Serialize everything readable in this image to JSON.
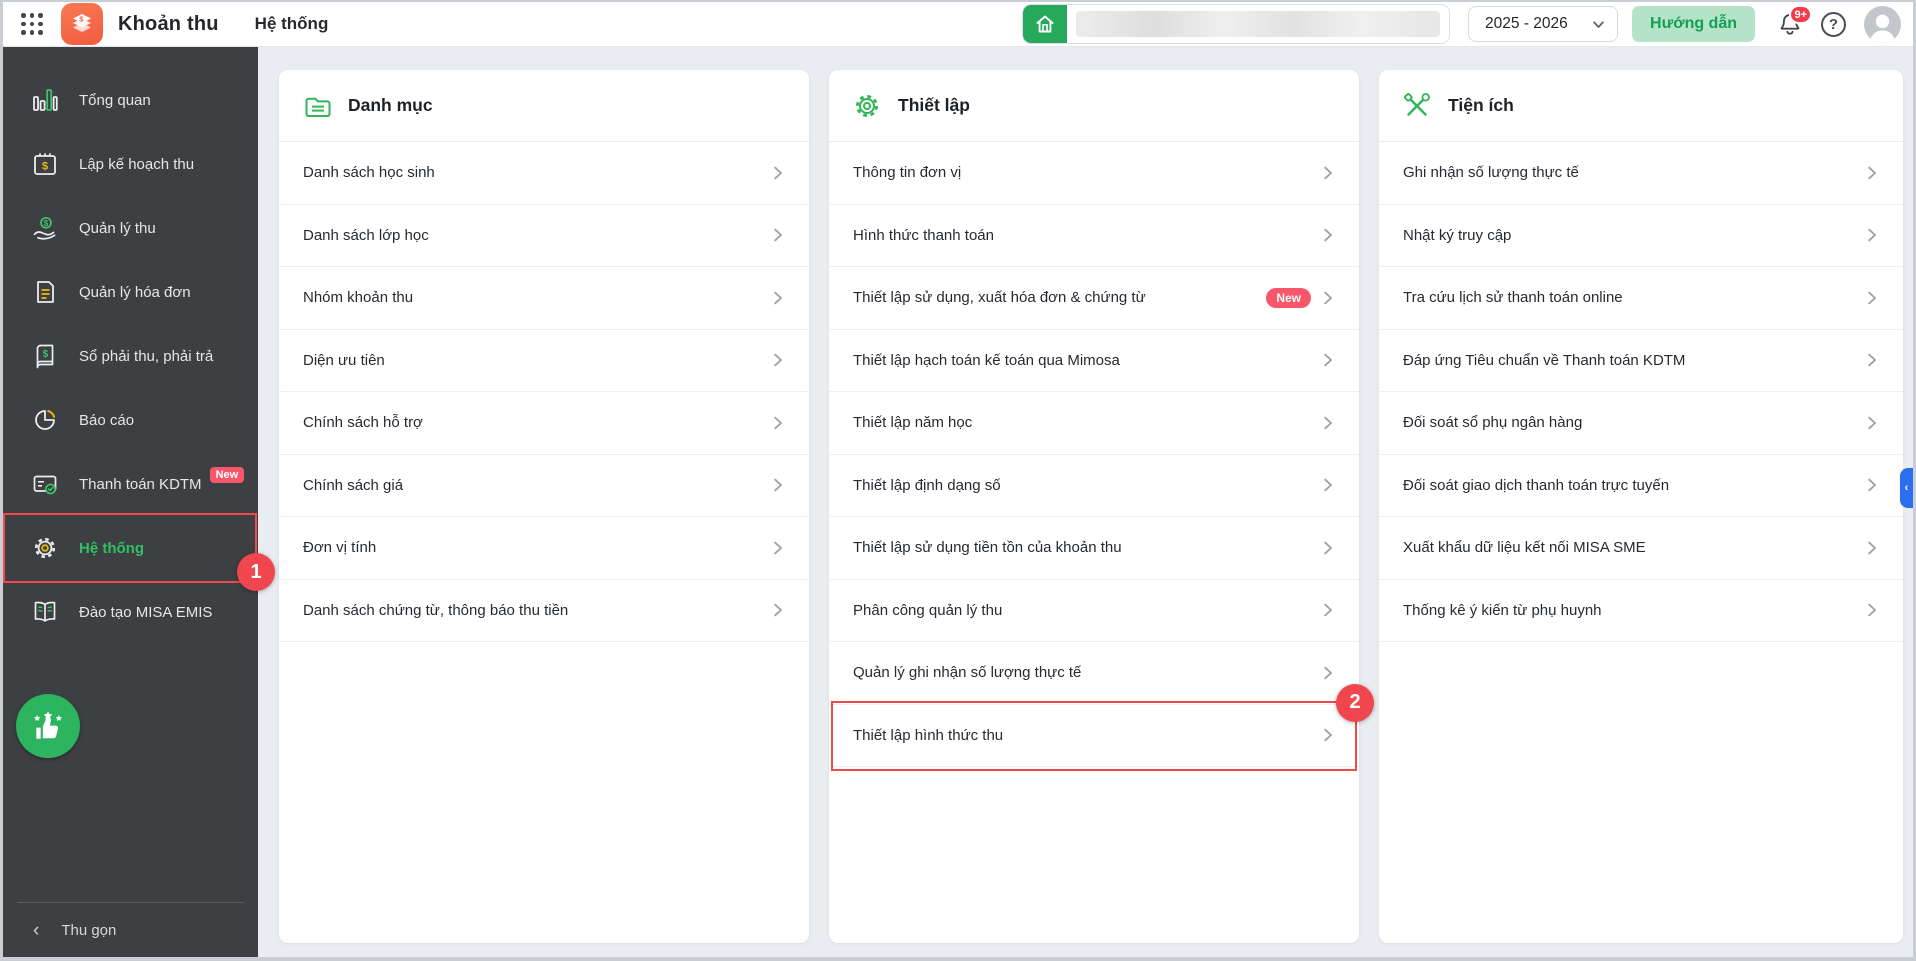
{
  "header": {
    "app_title": "Khoản thu",
    "breadcrumb": "Hệ thống",
    "school_year": "2025 - 2026",
    "guide_button": "Hướng dẫn",
    "notification_badge": "9+",
    "help_symbol": "?"
  },
  "colors": {
    "brand_green": "#2DB45F",
    "logo_orange": "#F4694A",
    "annotation_red": "#F04B4B",
    "new_badge_red": "#F8566A",
    "sidebar_bg": "#3D3F42",
    "main_bg": "#E9ECF1",
    "active_item_green": "#31C065"
  },
  "sidebar": {
    "items": [
      {
        "label": "Tổng quan",
        "icon": "bar-chart"
      },
      {
        "label": "Lập kế hoạch thu",
        "icon": "calendar-dollar"
      },
      {
        "label": "Quản lý thu",
        "icon": "hand-coin"
      },
      {
        "label": "Quản lý hóa đơn",
        "icon": "invoice"
      },
      {
        "label": "Sổ phải thu, phải trả",
        "icon": "ledger"
      },
      {
        "label": "Báo cáo",
        "icon": "pie-chart"
      },
      {
        "label": "Thanh toán KDTM",
        "icon": "card-check",
        "badge": "New"
      },
      {
        "label": "Hệ thống",
        "icon": "gear",
        "active": true,
        "annotation": "1"
      },
      {
        "label": "Đào tạo MISA EMIS",
        "icon": "open-book"
      }
    ],
    "collapse_label": "Thu gọn"
  },
  "columns": [
    {
      "title": "Danh mục",
      "icon": "folder",
      "items": [
        {
          "label": "Danh sách học sinh"
        },
        {
          "label": "Danh sách lớp học"
        },
        {
          "label": "Nhóm khoản thu"
        },
        {
          "label": "Diện ưu tiên"
        },
        {
          "label": "Chính sách hỗ trợ"
        },
        {
          "label": "Chính sách giá"
        },
        {
          "label": "Đơn vị tính"
        },
        {
          "label": "Danh sách chứng từ, thông báo thu tiền"
        }
      ]
    },
    {
      "title": "Thiết lập",
      "icon": "gear",
      "items": [
        {
          "label": "Thông tin đơn vị"
        },
        {
          "label": "Hình thức thanh toán"
        },
        {
          "label": "Thiết lập sử dụng, xuất hóa đơn & chứng từ",
          "badge": "New"
        },
        {
          "label": "Thiết lập hạch toán kế toán qua Mimosa"
        },
        {
          "label": "Thiết lập năm học"
        },
        {
          "label": "Thiết lập định dạng số"
        },
        {
          "label": "Thiết lập sử dụng tiền tồn của khoản thu"
        },
        {
          "label": "Phân công quản lý thu"
        },
        {
          "label": "Quản lý ghi nhận số lượng thực tế"
        },
        {
          "label": "Thiết lập hình thức thu",
          "annotation": "2"
        }
      ]
    },
    {
      "title": "Tiện ích",
      "icon": "tools",
      "items": [
        {
          "label": "Ghi nhận số lượng thực tế"
        },
        {
          "label": "Nhật ký truy cập"
        },
        {
          "label": "Tra cứu lịch sử thanh toán online"
        },
        {
          "label": "Đáp ứng Tiêu chuẩn về Thanh toán KDTM"
        },
        {
          "label": "Đối soát sổ phụ ngân hàng"
        },
        {
          "label": "Đối soát giao dịch thanh toán trực tuyến"
        },
        {
          "label": "Xuất khẩu dữ liệu kết nối MISA SME"
        },
        {
          "label": "Thống kê ý kiến từ phụ huynh"
        }
      ]
    }
  ],
  "annotations": {
    "step1": "1",
    "step2": "2"
  }
}
